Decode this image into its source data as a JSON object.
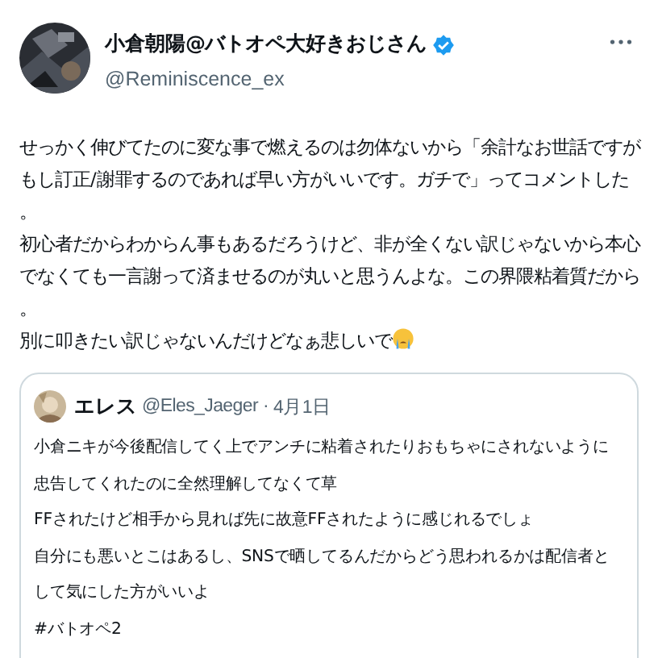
{
  "post": {
    "display_name": "小倉朝陽@バトオペ大好きおじさん",
    "verified": true,
    "handle": "@Reminiscence_ex",
    "paragraphs": [
      "せっかく伸びてたのに変な事で燃えるのは勿体ないから「余計なお世話ですがもし訂正/謝罪するのであれば早い方がいいです。ガチで」ってコメントした。",
      "初心者だからわからん事もあるだろうけど、非が全くない訳じゃないから本心でなくても一言謝って済ませるのが丸いと思うんよな。この界隈粘着質だから。",
      "別に叩きたい訳じゃないんだけどなぁ悲しいで"
    ]
  },
  "quoted_post": {
    "display_name": "エレス",
    "handle": "@Eles_Jaeger",
    "separator": "·",
    "date": "4月1日",
    "lines": [
      "小倉ニキが今後配信してく上でアンチに粘着されたりおもちゃにされないように",
      "忠告してくれたのに全然理解してなくて草",
      "FFされたけど相手から見れば先に故意FFされたように感じれるでしょ",
      "自分にも悪いとこはあるし、SNSで晒してるんだからどう思われるかは配信者と",
      "して気にした方がいいよ",
      "#バトオペ2"
    ]
  }
}
